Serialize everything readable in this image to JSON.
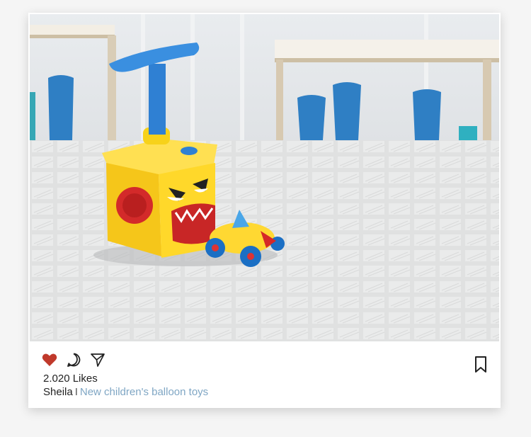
{
  "post": {
    "image_alt": "Yellow balloon-powered toy car launcher on a grey grid mat",
    "likes_text": "2.020 Likes",
    "author": "Sheila",
    "separator": "I",
    "description": "New children's balloon toys"
  },
  "actions": {
    "like_icon": "heart-icon",
    "comment_icon": "comment-icon",
    "share_icon": "send-icon",
    "bookmark_icon": "bookmark-icon"
  },
  "colors": {
    "heart": "#c0392b",
    "link": "#7fa6c4",
    "card_bg": "#ffffff",
    "page_bg": "#f5f5f5"
  }
}
